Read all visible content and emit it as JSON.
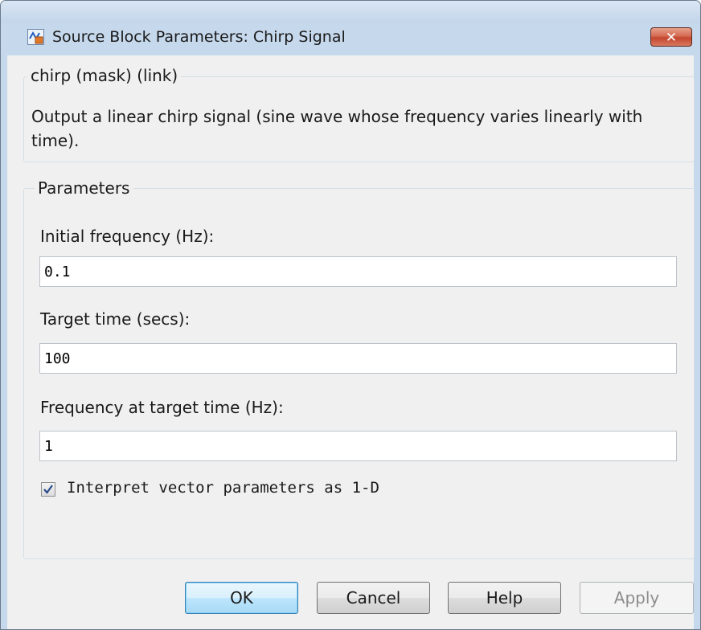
{
  "window": {
    "title": "Source Block Parameters: Chirp Signal",
    "close_label": "✕",
    "icon": "simulink-block-icon"
  },
  "mask_group": {
    "legend": "chirp (mask) (link)",
    "description": "Output a linear chirp signal (sine wave  whose frequency varies linearly with time)."
  },
  "parameters_group": {
    "legend": "Parameters",
    "fields": [
      {
        "label": "Initial frequency (Hz):",
        "value": "0.1"
      },
      {
        "label": "Target time (secs):",
        "value": "100"
      },
      {
        "label": "Frequency at target time (Hz):",
        "value": "1"
      }
    ],
    "checkbox": {
      "label": "Interpret vector parameters as 1-D",
      "checked": true
    }
  },
  "buttons": {
    "ok": "OK",
    "cancel": "Cancel",
    "help": "Help",
    "apply": "Apply"
  },
  "colors": {
    "frame": "#c6d8ec",
    "client": "#f0f0f0",
    "close_button": "#c4462e",
    "default_button": "#3c7fb1"
  }
}
